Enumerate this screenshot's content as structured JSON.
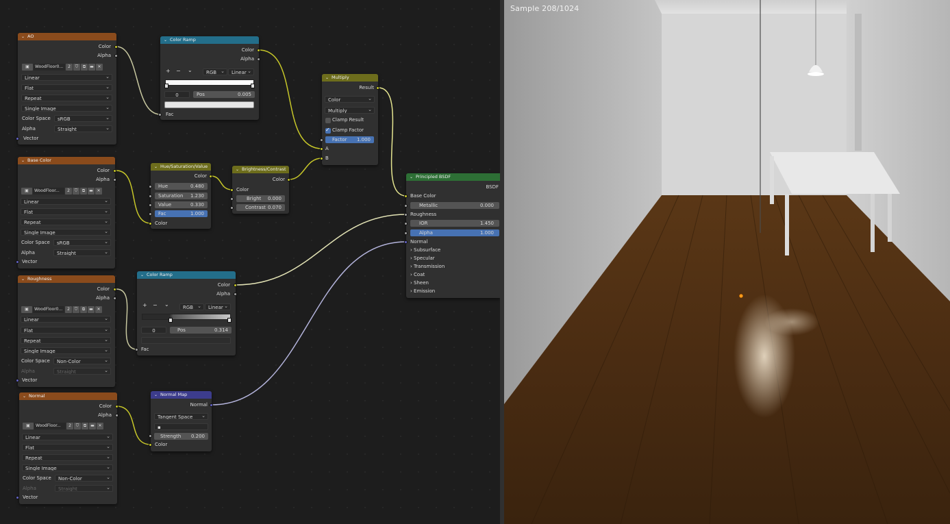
{
  "nodes": {
    "ao": {
      "title": "AO",
      "outputs": [
        "Color",
        "Alpha"
      ],
      "image_name": "WoodFloor0...",
      "users": "2",
      "interpolation": "Linear",
      "projection": "Flat",
      "extension": "Repeat",
      "source": "Single Image",
      "color_space_label": "Color Space",
      "color_space": "sRGB",
      "alpha_label": "Alpha",
      "alpha": "Straight",
      "input": "Vector"
    },
    "base_color": {
      "title": "Base Color",
      "outputs": [
        "Color",
        "Alpha"
      ],
      "image_name": "WoodFloor...",
      "users": "2",
      "interpolation": "Linear",
      "projection": "Flat",
      "extension": "Repeat",
      "source": "Single Image",
      "color_space_label": "Color Space",
      "color_space": "sRGB",
      "alpha_label": "Alpha",
      "alpha": "Straight",
      "input": "Vector"
    },
    "roughness": {
      "title": "Roughness",
      "outputs": [
        "Color",
        "Alpha"
      ],
      "image_name": "WoodFloor0...",
      "users": "2",
      "interpolation": "Linear",
      "projection": "Flat",
      "extension": "Repeat",
      "source": "Single Image",
      "color_space_label": "Color Space",
      "color_space": "Non-Color",
      "alpha_label": "Alpha",
      "alpha": "Straight",
      "input": "Vector"
    },
    "normal": {
      "title": "Normal",
      "outputs": [
        "Color",
        "Alpha"
      ],
      "image_name": "WoodFloor...",
      "users": "2",
      "interpolation": "Linear",
      "projection": "Flat",
      "extension": "Repeat",
      "source": "Single Image",
      "color_space_label": "Color Space",
      "color_space": "Non-Color",
      "alpha_label": "Alpha",
      "alpha": "Straight",
      "input": "Vector"
    },
    "ramp1": {
      "title": "Color Ramp",
      "outputs": [
        "Color",
        "Alpha"
      ],
      "mode": "RGB",
      "interp": "Linear",
      "index": "0",
      "pos_label": "Pos",
      "pos_value": "0.005",
      "input": "Fac"
    },
    "ramp2": {
      "title": "Color Ramp",
      "outputs": [
        "Color",
        "Alpha"
      ],
      "mode": "RGB",
      "interp": "Linear",
      "index": "0",
      "pos_label": "Pos",
      "pos_value": "0.314",
      "input": "Fac"
    },
    "hsv": {
      "title": "Hue/Saturation/Value",
      "output": "Color",
      "fields": [
        {
          "label": "Hue",
          "value": "0.480"
        },
        {
          "label": "Saturation",
          "value": "1.230"
        },
        {
          "label": "Value",
          "value": "0.330"
        },
        {
          "label": "Fac",
          "value": "1.000"
        }
      ],
      "input": "Color"
    },
    "bc": {
      "title": "Brightness/Contrast",
      "output": "Color",
      "input": "Color",
      "fields": [
        {
          "label": "Bright",
          "value": "0.000"
        },
        {
          "label": "Contrast",
          "value": "0.070"
        }
      ]
    },
    "multiply": {
      "title": "Multiply",
      "output": "Result",
      "data_type": "Color",
      "blend": "Multiply",
      "clamp_result": "Clamp Result",
      "clamp_factor": "Clamp Factor",
      "factor_label": "Factor",
      "factor_value": "1.000",
      "input_a": "A",
      "input_b": "B"
    },
    "bsdf": {
      "title": "Principled BSDF",
      "output": "BSDF",
      "base_color": "Base Color",
      "metallic_label": "Metallic",
      "metallic_value": "0.000",
      "roughness": "Roughness",
      "ior_label": "IOR",
      "ior_value": "1.450",
      "alpha_label": "Alpha",
      "alpha_value": "1.000",
      "normal": "Normal",
      "panels": [
        "Subsurface",
        "Specular",
        "Transmission",
        "Coat",
        "Sheen",
        "Emission"
      ]
    },
    "normal_map": {
      "title": "Normal Map",
      "output": "Normal",
      "space": "Tangent Space",
      "uv": "",
      "strength_label": "Strength",
      "strength_value": "0.200",
      "input": "Color"
    }
  },
  "viewport": {
    "status": "Sample 208/1024"
  },
  "colors": {
    "texture_header": "#8a4b1c",
    "converter_header": "#236e8a",
    "color_header": "#6d6d1c",
    "shader_header": "#2d6f35",
    "vector_header": "#3c3c8c",
    "active_field": "#4772b3",
    "socket_color": "#c7c729",
    "socket_float": "#a1a1a1",
    "socket_vector": "#6363c7"
  }
}
